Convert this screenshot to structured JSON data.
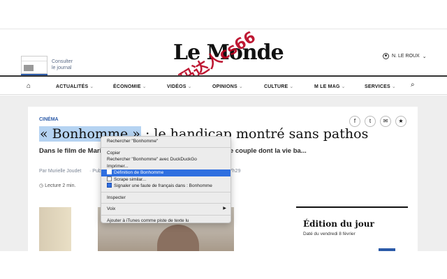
{
  "header": {
    "journal_label_1": "Consulter",
    "journal_label_2": "le journal",
    "logo": "Le Monde",
    "watermark": "数码达人cs66",
    "user_name": "N. LE ROUX"
  },
  "nav": {
    "items": [
      {
        "label": "ACTUALITÉS"
      },
      {
        "label": "ÉCONOMIE"
      },
      {
        "label": "VIDÉOS"
      },
      {
        "label": "OPINIONS"
      },
      {
        "label": "CULTURE"
      },
      {
        "label": "M LE MAG"
      },
      {
        "label": "SERVICES"
      }
    ]
  },
  "article": {
    "section": "CINÉMA",
    "title_highlight": "« Bonhomme »",
    "title_rest": " : le handicap montré sans pathos",
    "lead": "Dans le film de Mario... elle incarnent gracieusement un jeune couple dont la vie ba...",
    "author": "Par Murielle Joudet",
    "published": "· Pub",
    "time": "07h29",
    "reading_time": "Lecture 2 min."
  },
  "share_icons": [
    "f",
    "t",
    "✉",
    "★"
  ],
  "edition": {
    "title": "Édition du jour",
    "date": "Daté du vendredi 8 février"
  },
  "context_menu": {
    "items": [
      {
        "label": "Rechercher \"Bonhomme\""
      },
      {
        "label": "Copier"
      },
      {
        "label": "Rechercher \"Bonhomme\" avec DuckDuckGo"
      },
      {
        "label": "Imprimer..."
      },
      {
        "label": "Définition de Bonhomme"
      },
      {
        "label": "Scrape similar..."
      },
      {
        "label": "Signaler une faute de français dans : Bonhomme"
      },
      {
        "label": "Inspecter"
      },
      {
        "label": "Voix"
      },
      {
        "label": "Ajouter à iTunes comme piste de texte lu"
      }
    ]
  }
}
